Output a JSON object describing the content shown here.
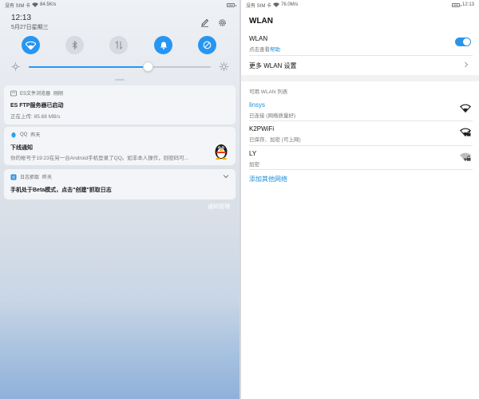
{
  "left": {
    "status": {
      "carrier": "没有 SIM 卡",
      "speed": "84.5K/s"
    },
    "clock": {
      "time": "12:13",
      "date": "5月27日星期三"
    },
    "tiles": [
      {
        "name": "wifi",
        "on": true
      },
      {
        "name": "bluetooth",
        "on": false
      },
      {
        "name": "mobile-data",
        "on": false
      },
      {
        "name": "sound",
        "on": true
      },
      {
        "name": "auto-rotate",
        "on": true
      }
    ],
    "brightness": {
      "level": 0.66
    },
    "notifications": [
      {
        "app": "ES文件浏览器",
        "time": "刚刚",
        "title": "ES FTP服务器已启动",
        "body": "正在上传: 85.68 MB/s"
      },
      {
        "app": "QQ",
        "time": "昨天",
        "title": "下线通知",
        "body": "你的帐号于19:23在另一台Android手机登录了QQ。如非本人操作，则密码可..."
      },
      {
        "app": "日志抓取",
        "time": "昨天",
        "title": "手机处于Beta模式，点击\"创建\"抓取日志",
        "body": ""
      }
    ],
    "manage_label": "通知管理"
  },
  "right": {
    "status": {
      "carrier": "没有 SIM 卡",
      "speed": "76.0M/s",
      "time": "12:13"
    },
    "title": "WLAN",
    "wlan_row": {
      "label": "WLAN",
      "sub_prefix": "点击查看",
      "sub_link": "帮助",
      "enabled": true
    },
    "more_settings": "更多 WLAN 设置",
    "section": "可用 WLAN 列表",
    "networks": [
      {
        "ssid": "linsys",
        "status": "已连接 (网络质量好)",
        "connected": true,
        "secured": false
      },
      {
        "ssid": "K2PWiFi",
        "status": "已保存、加密 (可上网)",
        "connected": false,
        "secured": true
      },
      {
        "ssid": "LY",
        "status": "加密",
        "connected": false,
        "secured": true
      }
    ],
    "add_network": "添加其他网络"
  },
  "colors": {
    "accent": "#2796f2",
    "link": "#1e8ed8",
    "connected_ssid": "#1e8ed8"
  }
}
